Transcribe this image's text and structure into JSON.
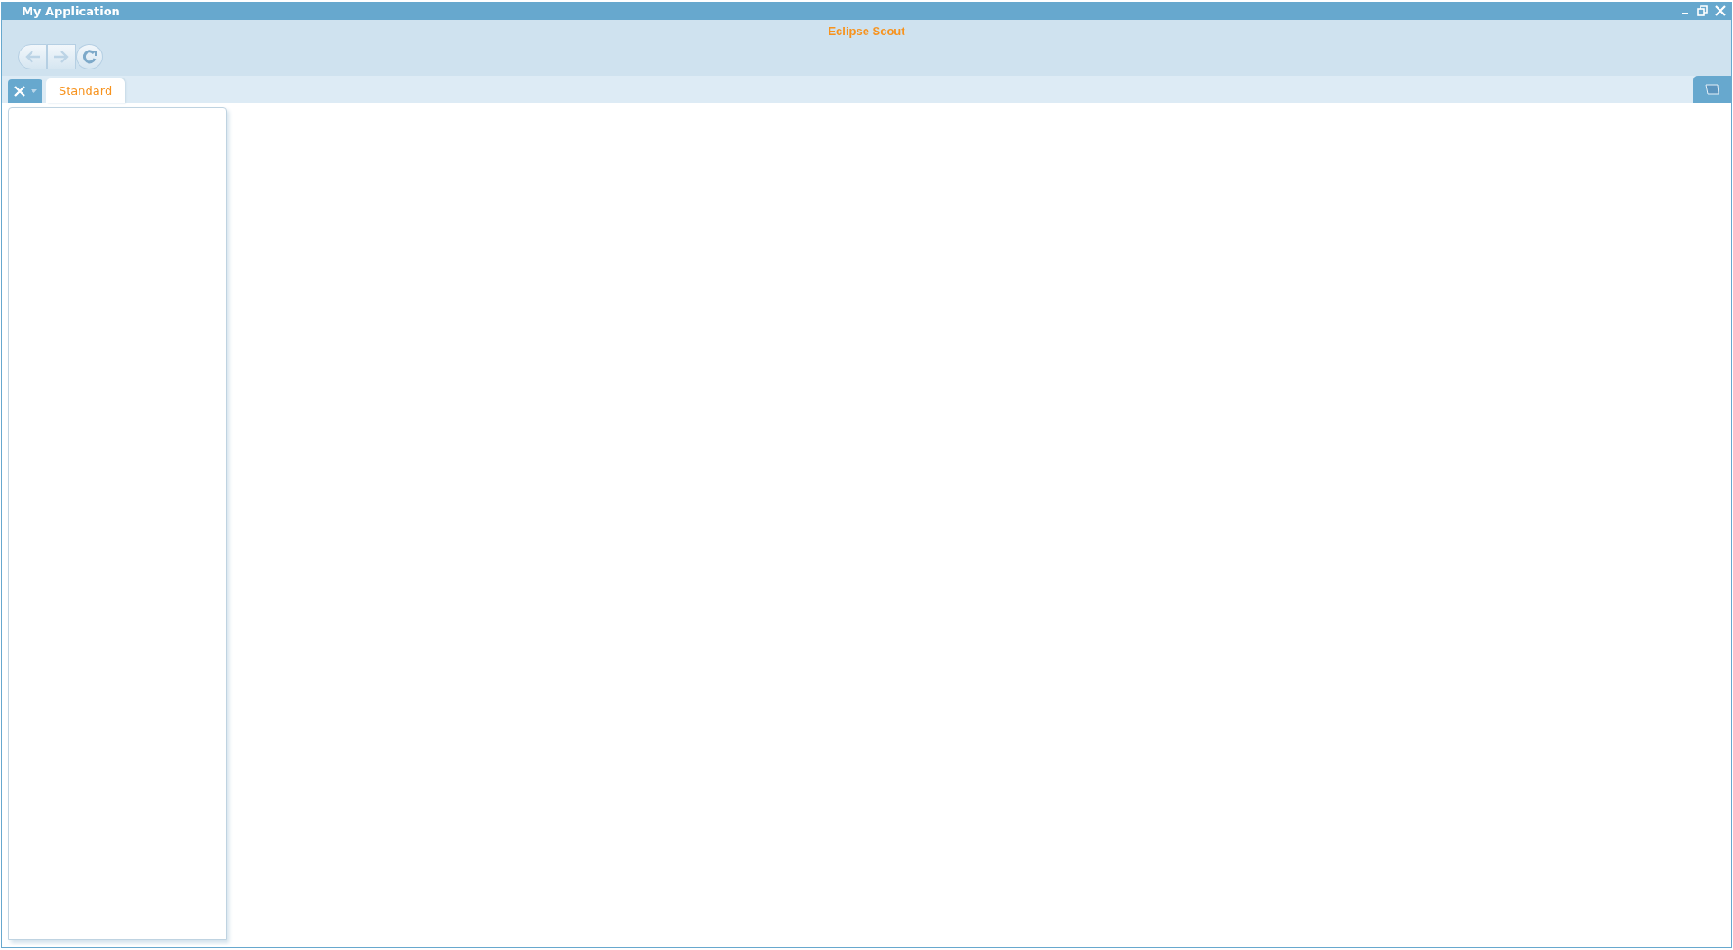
{
  "window": {
    "title": "My Application"
  },
  "header": {
    "brand": "Eclipse Scout"
  },
  "tabs": [
    {
      "label": "Standard",
      "selected": true
    }
  ]
}
